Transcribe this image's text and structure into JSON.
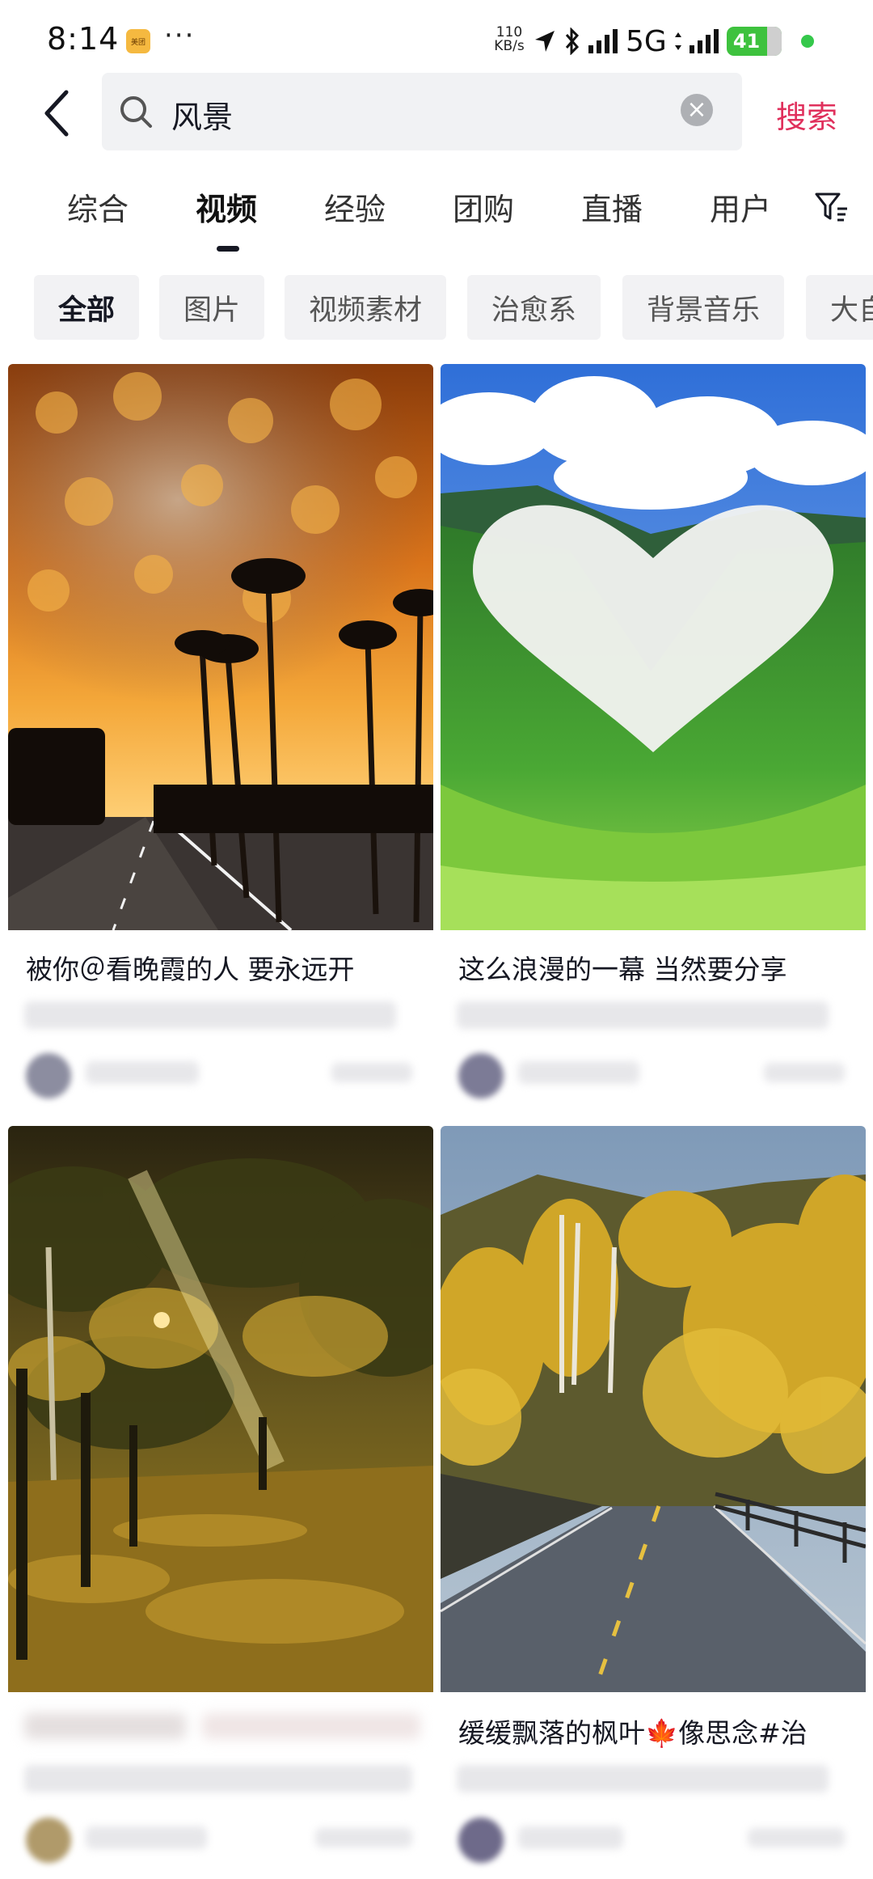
{
  "status_bar": {
    "time": "8:14",
    "app_icon_label": "美团",
    "more": "···",
    "speed_value": "110",
    "speed_unit": "KB/s",
    "network": "5G",
    "battery": "41"
  },
  "search": {
    "query": "风景",
    "submit_label": "搜索"
  },
  "tabs": [
    {
      "label": "综合"
    },
    {
      "label": "视频"
    },
    {
      "label": "经验"
    },
    {
      "label": "团购"
    },
    {
      "label": "直播"
    },
    {
      "label": "用户"
    }
  ],
  "active_tab": "视频",
  "filter_chips": [
    {
      "label": "全部"
    },
    {
      "label": "图片"
    },
    {
      "label": "视频素材"
    },
    {
      "label": "治愈系"
    },
    {
      "label": "背景音乐"
    },
    {
      "label": "大自"
    }
  ],
  "active_chip": "全部",
  "cards": [
    {
      "title": "被你＠看晚霞的人 要永远开",
      "image": "sunset-palm-road"
    },
    {
      "title": "这么浪漫的一幕 当然要分享",
      "image": "heart-cloud-valley"
    },
    {
      "title": "",
      "image": "autumn-night-road"
    },
    {
      "title": "缓缓飘落的枫叶🍁像思念#治",
      "image": "autumn-mountain-road"
    }
  ],
  "colors": {
    "accent": "#e0305c",
    "text": "#161823",
    "chip_bg": "#f2f2f4",
    "search_bg": "#f1f2f4",
    "battery": "#3ec23e"
  }
}
